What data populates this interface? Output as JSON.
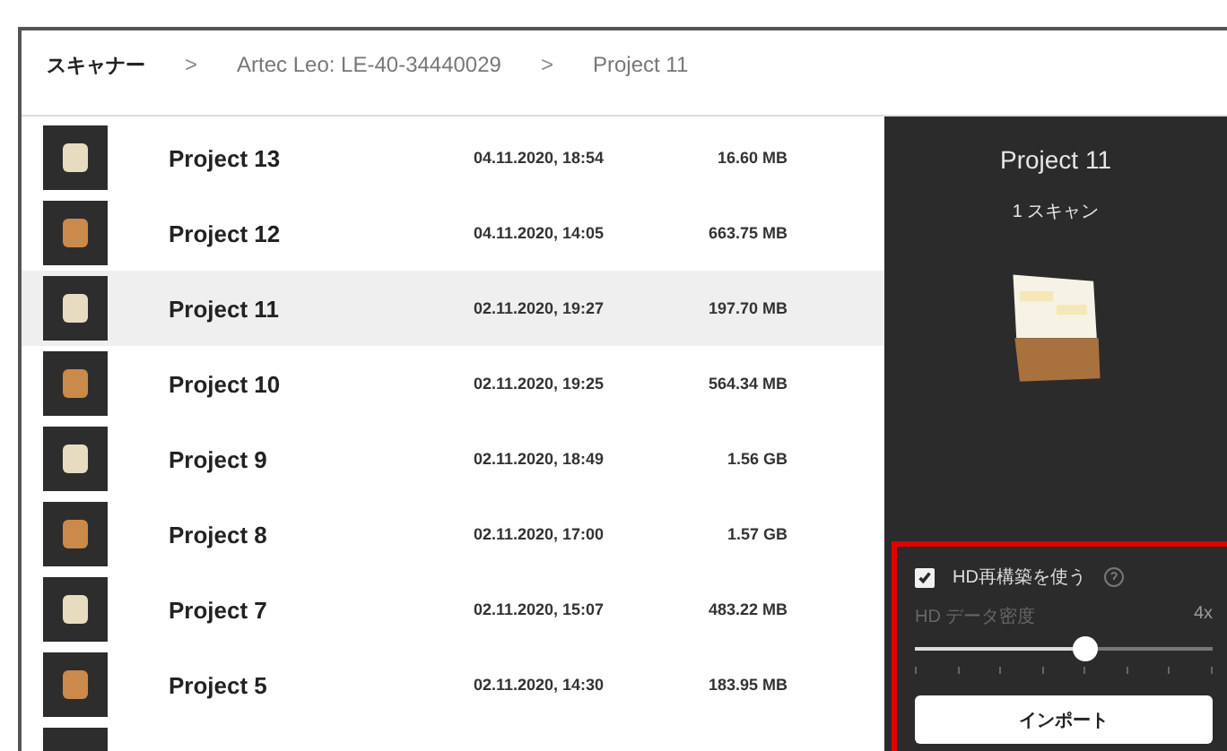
{
  "breadcrumb": [
    "スキャナー",
    "Artec Leo: LE-40-34440029",
    "Project 11"
  ],
  "breadcrumb_separator": ">",
  "projects": [
    {
      "name": "Project 13",
      "date": "04.11.2020, 18:54",
      "size": "16.60 MB",
      "selected": false
    },
    {
      "name": "Project 12",
      "date": "04.11.2020, 14:05",
      "size": "663.75 MB",
      "selected": false
    },
    {
      "name": "Project 11",
      "date": "02.11.2020, 19:27",
      "size": "197.70 MB",
      "selected": true
    },
    {
      "name": "Project 10",
      "date": "02.11.2020, 19:25",
      "size": "564.34 MB",
      "selected": false
    },
    {
      "name": "Project 9",
      "date": "02.11.2020, 18:49",
      "size": "1.56 GB",
      "selected": false
    },
    {
      "name": "Project 8",
      "date": "02.11.2020, 17:00",
      "size": "1.57 GB",
      "selected": false
    },
    {
      "name": "Project 7",
      "date": "02.11.2020, 15:07",
      "size": "483.22 MB",
      "selected": false
    },
    {
      "name": "Project 5",
      "date": "02.11.2020, 14:30",
      "size": "183.95 MB",
      "selected": false
    }
  ],
  "details": {
    "title": "Project 11",
    "scan_count": "1 スキャン",
    "hd_option": {
      "label": "HD再構築を使う",
      "checked": true
    },
    "density": {
      "label": "HD データ密度",
      "value": "4x",
      "level": 0.57
    },
    "import_button": "インポート",
    "highlighted": true
  }
}
